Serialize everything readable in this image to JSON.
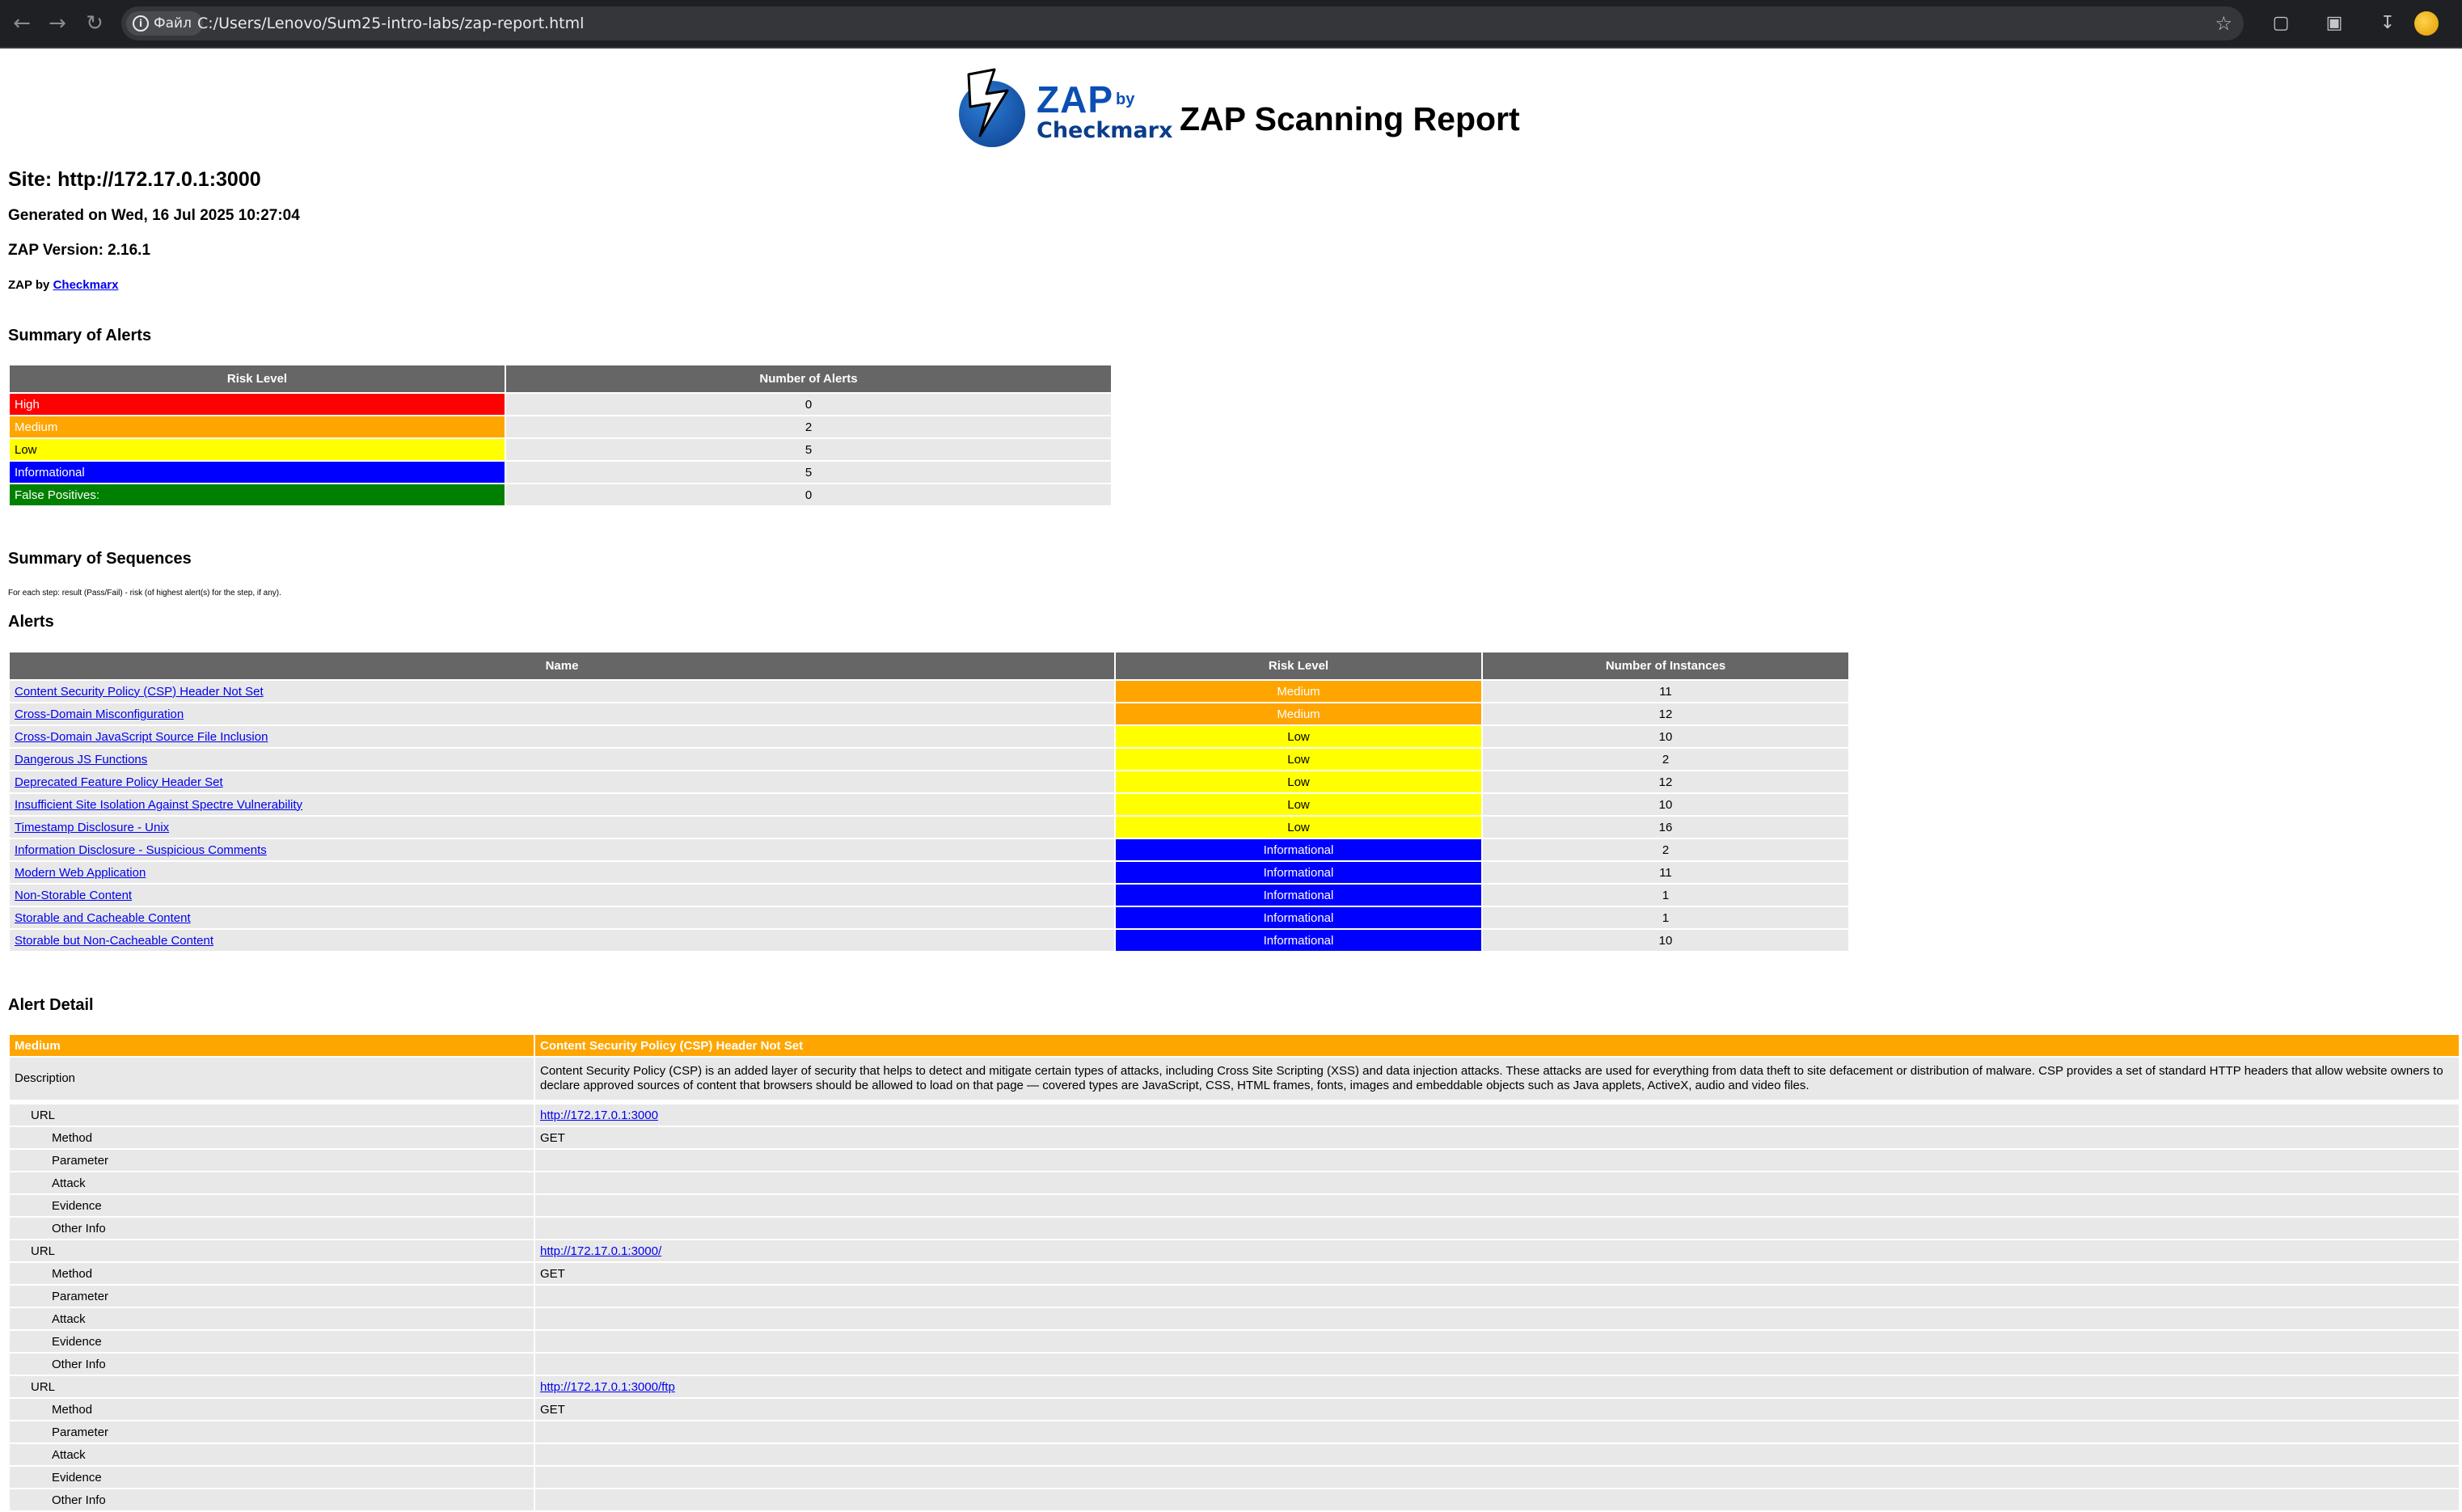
{
  "browser": {
    "file_chip": "Файл",
    "url": "C:/Users/Lenovo/Sum25-intro-labs/zap-report.html"
  },
  "report": {
    "logo_zap": "ZAP",
    "logo_by": "by",
    "logo_checkmarx": "Checkmarx",
    "title": "ZAP Scanning Report",
    "site": "Site: http://172.17.0.1:3000",
    "generated": "Generated on Wed, 16 Jul 2025 10:27:04",
    "version": "ZAP Version: 2.16.1",
    "zap_by_prefix": "ZAP by",
    "zap_by_link": "Checkmarx"
  },
  "summary": {
    "heading": "Summary of Alerts",
    "col_risk": "Risk Level",
    "col_count": "Number of Alerts",
    "rows": [
      {
        "level": "High",
        "count": "0",
        "color": "#ff0000"
      },
      {
        "level": "Medium",
        "count": "2",
        "color": "#ffa500"
      },
      {
        "level": "Low",
        "count": "5",
        "color": "#ffff00"
      },
      {
        "level": "Informational",
        "count": "5",
        "color": "#0000ff"
      },
      {
        "level": "False Positives:",
        "count": "0",
        "color": "#008000"
      }
    ]
  },
  "sequences": {
    "heading": "Summary of Sequences",
    "note": "For each step: result (Pass/Fail) - risk (of highest alert(s) for the step, if any)."
  },
  "alerts": {
    "heading": "Alerts",
    "col_name": "Name",
    "col_risk": "Risk Level",
    "col_instances": "Number of Instances",
    "rows": [
      {
        "name": "Content Security Policy (CSP) Header Not Set",
        "risk": "Medium",
        "instances": "11"
      },
      {
        "name": "Cross-Domain Misconfiguration",
        "risk": "Medium",
        "instances": "12"
      },
      {
        "name": "Cross-Domain JavaScript Source File Inclusion",
        "risk": "Low",
        "instances": "10"
      },
      {
        "name": "Dangerous JS Functions",
        "risk": "Low",
        "instances": "2"
      },
      {
        "name": "Deprecated Feature Policy Header Set",
        "risk": "Low",
        "instances": "12"
      },
      {
        "name": "Insufficient Site Isolation Against Spectre Vulnerability",
        "risk": "Low",
        "instances": "10"
      },
      {
        "name": "Timestamp Disclosure - Unix",
        "risk": "Low",
        "instances": "16"
      },
      {
        "name": "Information Disclosure - Suspicious Comments",
        "risk": "Informational",
        "instances": "2"
      },
      {
        "name": "Modern Web Application",
        "risk": "Informational",
        "instances": "11"
      },
      {
        "name": "Non-Storable Content",
        "risk": "Informational",
        "instances": "1"
      },
      {
        "name": "Storable and Cacheable Content",
        "risk": "Informational",
        "instances": "1"
      },
      {
        "name": "Storable but Non-Cacheable Content",
        "risk": "Informational",
        "instances": "10"
      }
    ]
  },
  "detail": {
    "heading": "Alert Detail",
    "risk": "Medium",
    "name": "Content Security Policy (CSP) Header Not Set",
    "description_label": "Description",
    "description": "Content Security Policy (CSP) is an added layer of security that helps to detect and mitigate certain types of attacks, including Cross Site Scripting (XSS) and data injection attacks. These attacks are used for everything from data theft to site defacement or distribution of malware. CSP provides a set of standard HTTP headers that allow website owners to declare approved sources of content that browsers should be allowed to load on that page — covered types are JavaScript, CSS, HTML frames, fonts, images and embeddable objects such as Java applets, ActiveX, audio and video files.",
    "labels": {
      "url": "URL",
      "method": "Method",
      "parameter": "Parameter",
      "attack": "Attack",
      "evidence": "Evidence",
      "other_info": "Other Info"
    },
    "instances": [
      {
        "url": "http://172.17.0.1:3000",
        "method": "GET"
      },
      {
        "url": "http://172.17.0.1:3000/",
        "method": "GET"
      },
      {
        "url": "http://172.17.0.1:3000/ftp",
        "method": "GET"
      }
    ]
  }
}
